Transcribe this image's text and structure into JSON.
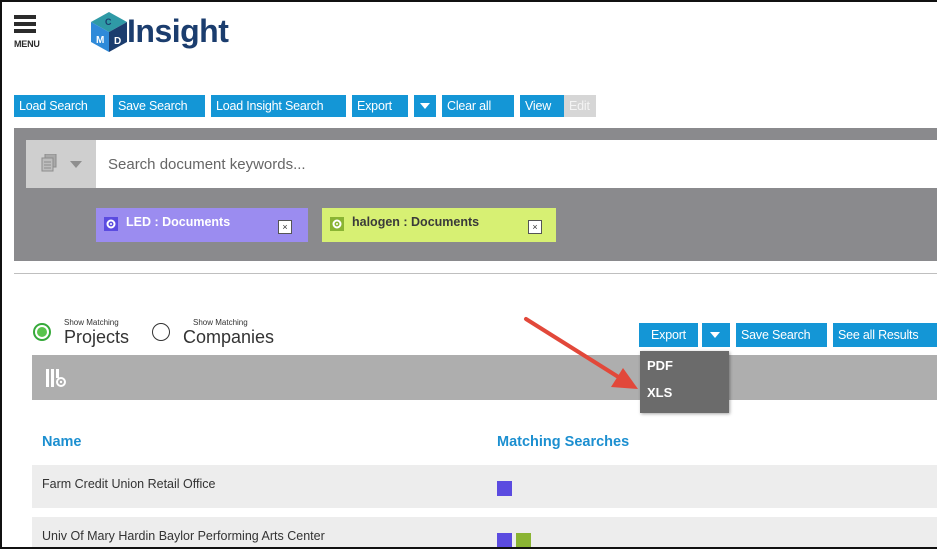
{
  "header": {
    "menu_label": "MENU",
    "logo_text": "Insight",
    "logo_colors": {
      "navy": "#1b3d6e",
      "teal": "#2f9aa6",
      "blue": "#2f8ad9"
    }
  },
  "toolbar": {
    "load_search": "Load Search",
    "save_search": "Save Search",
    "load_insight_search": "Load Insight Search",
    "export": "Export",
    "clear_all": "Clear all",
    "view": "View",
    "edit": "Edit",
    "accent": "#1496d6"
  },
  "search": {
    "placeholder": "Search document keywords...",
    "doc_icon": "documents-icon"
  },
  "chips": [
    {
      "label": "LED : Documents",
      "color": "#9b8cf0",
      "icon_color": "#5b4be0",
      "close": "×"
    },
    {
      "label": "halogen : Documents",
      "color": "#d7f073",
      "icon_color": "#8ab433",
      "close": "×"
    }
  ],
  "results": {
    "radio_projects_small": "Show Matching",
    "radio_projects_big": "Projects",
    "radio_companies_small": "Show Matching",
    "radio_companies_big": "Companies",
    "export": "Export",
    "save_search": "Save Search",
    "see_all_results": "See all Results",
    "export_menu": [
      "PDF",
      "XLS"
    ],
    "columns": [
      "Name",
      "Matching Searches"
    ],
    "rows": [
      {
        "name": "Farm Credit Union Retail Office",
        "matches": [
          "#5b4be0"
        ]
      },
      {
        "name": "Univ Of Mary Hardin Baylor Performing Arts Center",
        "matches": [
          "#5b4be0",
          "#8ab433"
        ]
      }
    ],
    "annotation_arrow_color": "#e2483a"
  }
}
